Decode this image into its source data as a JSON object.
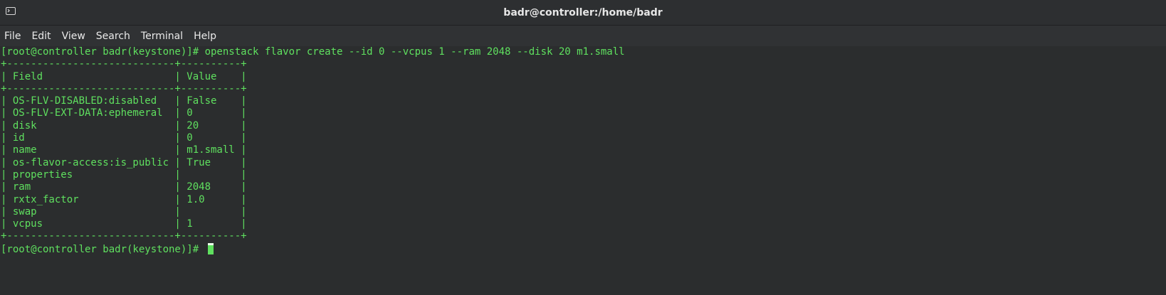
{
  "window": {
    "title": "badr@controller:/home/badr",
    "icon": "terminal-icon"
  },
  "menubar": {
    "items": [
      "File",
      "Edit",
      "View",
      "Search",
      "Terminal",
      "Help"
    ]
  },
  "terminal": {
    "prompt": "[root@controller badr(keystone)]#",
    "command": "openstack flavor create --id 0 --vcpus 1 --ram 2048 --disk 20 m1.small",
    "table_header": {
      "field": "Field",
      "value": "Value"
    },
    "rows": [
      {
        "field": "OS-FLV-DISABLED:disabled",
        "value": "False"
      },
      {
        "field": "OS-FLV-EXT-DATA:ephemeral",
        "value": "0"
      },
      {
        "field": "disk",
        "value": "20"
      },
      {
        "field": "id",
        "value": "0"
      },
      {
        "field": "name",
        "value": "m1.small"
      },
      {
        "field": "os-flavor-access:is_public",
        "value": "True"
      },
      {
        "field": "properties",
        "value": ""
      },
      {
        "field": "ram",
        "value": "2048"
      },
      {
        "field": "rxtx_factor",
        "value": "1.0"
      },
      {
        "field": "swap",
        "value": ""
      },
      {
        "field": "vcpus",
        "value": "1"
      }
    ],
    "final_prompt": "[root@controller badr(keystone)]#"
  },
  "colors": {
    "text": "#5fe05f",
    "background": "#2b2d2e"
  }
}
